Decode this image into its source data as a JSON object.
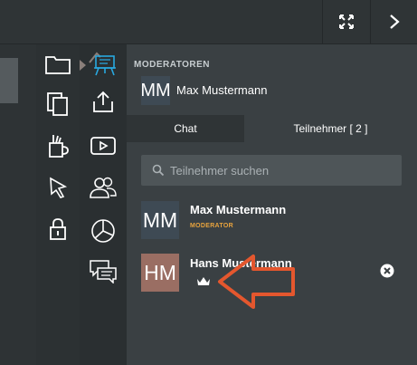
{
  "topbar": {
    "fullscreen_icon": "fullscreen-icon",
    "forward_icon": "chevron-right-icon"
  },
  "sidebar_col1": [
    "folder-icon",
    "copy-icon",
    "tools-icon",
    "pointer-icon",
    "lock-icon"
  ],
  "sidebar_col2": [
    "presentation-icon",
    "upload-icon",
    "video-icon",
    "users-icon",
    "pie-chart-icon",
    "chat-bubbles-icon"
  ],
  "moderators": {
    "title": "MODERATOREN",
    "items": [
      {
        "initials": "MM",
        "name": "Max Mustermann"
      }
    ]
  },
  "tabs": {
    "chat": "Chat",
    "participants": "Teilnehmer [ 2 ]"
  },
  "search": {
    "placeholder": "Teilnehmer suchen"
  },
  "participants": [
    {
      "initials": "MM",
      "name": "Max Mustermann",
      "role": "MODERATOR",
      "avatar_color": "#3e4a54"
    },
    {
      "initials": "HM",
      "name": "Hans Mustermann",
      "role": "",
      "avatar_color": "#9a6e63"
    }
  ],
  "colors": {
    "accent_blue": "#29a8e0",
    "moderator_orange": "#e8a33d",
    "arrow_red": "#e4572e"
  }
}
